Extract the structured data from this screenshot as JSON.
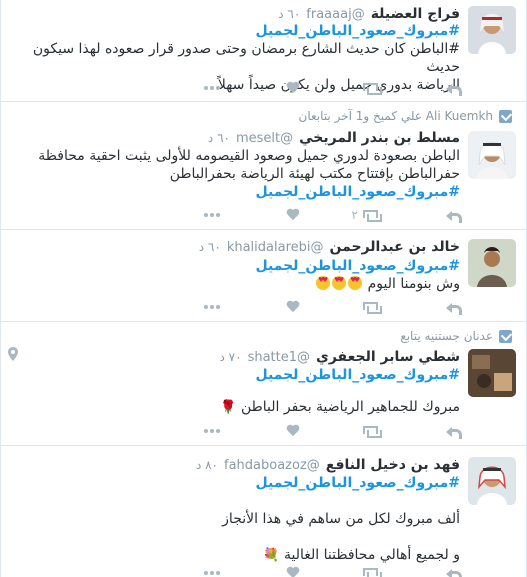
{
  "tweets": [
    {
      "name": "فراج العضيلة",
      "handle": "@fraaaaj",
      "time": "٦٠ د",
      "hashtag": "#مبروك_صعود_الباطن_لجميل",
      "text_lines": [
        "#الباطن كان حديث الشارع برمضان وحتى صدور قرار صعوده لهذا سيكون حديث",
        "الرياضة بدوري جميل ولن يكون صيداً سهلاً"
      ],
      "actions": {
        "reply": "reply-icon",
        "retweet": "retweet-icon",
        "like": "heart-icon",
        "more": "more-icon"
      }
    },
    {
      "retweeted_by": "Ali Kuemkh علي كميخ و1 آخر بتابعان",
      "name": "مسلط بن بندر المريخي",
      "handle": "@meselt",
      "time": "٦٠ د",
      "text_lines": [
        "الباطن بصعودة لدوري جميل وصعود القيصومه للأولى يثبت احقية محافظة",
        "حفرالباطن بإفتتاح مكتب لهيئة الرياضة بحفرالباطن"
      ],
      "hashtag": "#مبروك_صعود_الباطن_لجميل",
      "retweet_count": "٢"
    },
    {
      "name": "خالد بن عبدالرحمن",
      "handle": "@khalidalarebi",
      "time": "٦٠ د",
      "hashtag": "#مبروك_صعود_الباطن_لجميل",
      "text": "وش بنومنا اليوم"
    },
    {
      "retweeted_by": "عدنان جستنيه يتابع",
      "name": "شطي سابر الجعفري",
      "handle": "@shatte1",
      "time": "٧٠ د",
      "hashtag": "#مبروك_صعود_الباطن_لجميل",
      "text": "مبروك للجماهير الرياضية بحفر الباطن"
    },
    {
      "name": "فهد بن دخيل النافع",
      "handle": "@fahdaboazoz",
      "time": "٨٠ د",
      "hashtag": "#مبروك_صعود_الباطن_لجميل",
      "text_lines": [
        "ألف مبروك لكل من ساهم في هذا الأنجاز",
        "و لجميع أهالي محافظتنا الغالية"
      ]
    }
  ]
}
